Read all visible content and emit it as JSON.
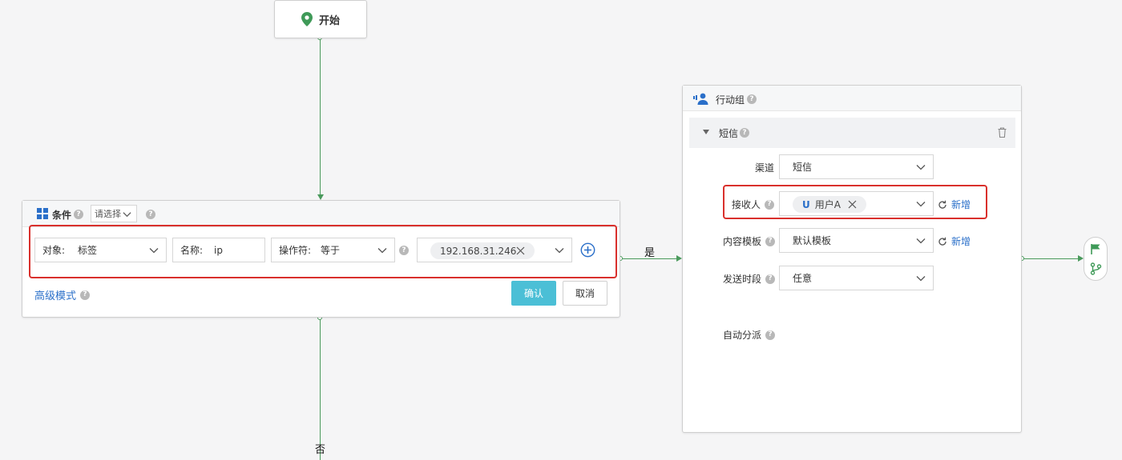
{
  "start_node": {
    "label": "开始",
    "icon": "location-pin-icon"
  },
  "condition_node": {
    "title": "条件",
    "mode_select": "请选择",
    "object": {
      "label": "对象:",
      "value": "标签"
    },
    "name": {
      "label": "名称:",
      "value": "ip"
    },
    "operator": {
      "label": "操作符:",
      "value": "等于"
    },
    "value_tag": "192.168.31.246",
    "advanced_mode": "高级模式",
    "confirm": "确认",
    "cancel": "取消"
  },
  "edges": {
    "yes": "是",
    "no": "否"
  },
  "action_group": {
    "title": "行动组",
    "section": "短信",
    "channel": {
      "label": "渠道",
      "value": "短信"
    },
    "recipient": {
      "label": "接收人",
      "tag_prefix": "U",
      "tag": "用户A",
      "add": "新增"
    },
    "template": {
      "label": "内容模板",
      "value": "默认模板",
      "add": "新增"
    },
    "send_time": {
      "label": "发送时段",
      "value": "任意"
    },
    "auto_assign": {
      "label": "自动分派"
    }
  },
  "colors": {
    "flow_green": "#4a9a5c",
    "confirm_bg": "#4bbfd6",
    "highlight_red": "#d9302c",
    "link_blue": "#2a6fc9"
  }
}
